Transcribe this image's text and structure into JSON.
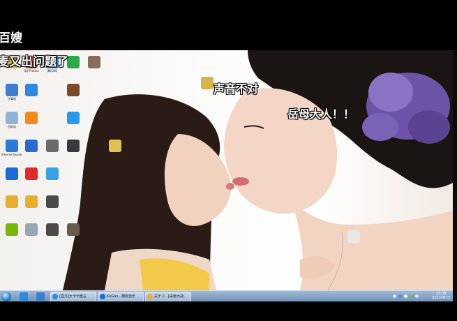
{
  "overlay_comments": [
    {
      "text": "百嫂"
    },
    {
      "text": "麦又出问题了"
    },
    {
      "text": "声音不对"
    },
    {
      "text": "岳母大人！！"
    }
  ],
  "desktop_icons": [
    {
      "label": "",
      "icon": "folder-icon",
      "color": "#d9b24a"
    },
    {
      "label": "QQ Protect",
      "icon": "qq-icon",
      "color": "#e23b2b"
    },
    {
      "label": "腾讯QQ",
      "icon": "qq-penguin-icon",
      "color": "#1a7fd6"
    },
    {
      "label": "",
      "icon": "green-app-icon",
      "color": "#2aa84a"
    },
    {
      "label": "",
      "icon": "image-file-icon",
      "color": "#8a6c5a"
    },
    {
      "label": "计算机",
      "icon": "computer-icon",
      "color": "#3b7fd0"
    },
    {
      "label": "",
      "icon": "browser-icon",
      "color": "#2a8ae0"
    },
    {
      "label": "",
      "icon": "video-file-icon",
      "color": "#7a4a2a"
    },
    {
      "label": "回收站",
      "icon": "recycle-bin-icon",
      "color": "#8fb3d8"
    },
    {
      "label": "",
      "icon": "orange-app-icon",
      "color": "#f08a1a"
    },
    {
      "label": "",
      "icon": "bird-app-icon",
      "color": "#2a9ae8"
    },
    {
      "label": "Internet Explorer",
      "icon": "ie-icon",
      "color": "#2a7ad8"
    },
    {
      "label": "",
      "icon": "shield-icon",
      "color": "#2a6ad0"
    },
    {
      "label": "",
      "icon": "phone-icon",
      "color": "#6a6a6a"
    },
    {
      "label": "",
      "icon": "video-file-icon",
      "color": "#3a3a3a"
    },
    {
      "label": "",
      "icon": "kugou-icon",
      "color": "#1a6ad8"
    },
    {
      "label": "",
      "icon": "media-player-icon",
      "color": "#e02a2a"
    },
    {
      "label": "",
      "icon": "photo-app-icon",
      "color": "#3aa0e8"
    },
    {
      "label": "",
      "icon": "game-app-icon",
      "color": "#e8b02a"
    },
    {
      "label": "",
      "icon": "game-app-icon",
      "color": "#e8b02a"
    },
    {
      "label": "",
      "icon": "video-file-icon",
      "color": "#4a4a4a"
    },
    {
      "label": "",
      "icon": "nvidia-icon",
      "color": "#76b900"
    },
    {
      "label": "",
      "icon": "keyboard-icon",
      "color": "#9aa6b2"
    },
    {
      "label": "",
      "icon": "video-file-icon",
      "color": "#4a4a4a"
    },
    {
      "label": "",
      "icon": "person-file-icon",
      "color": "#6a5a4a"
    },
    {
      "label": "",
      "icon": "folder-icon",
      "color": "#e0c050"
    },
    {
      "label": "",
      "icon": "file-icon",
      "color": "#e8e8e8"
    },
    {
      "label": "",
      "icon": "folder-icon",
      "color": "#d9b24a"
    }
  ],
  "taskbar": {
    "buttons": [
      {
        "label": "[直方]大卡卡盘古",
        "icon": "qq-icon",
        "color": "#2a8ae0"
      },
      {
        "label": "KuGou - 酷狗音乐",
        "icon": "kugou-icon",
        "color": "#1a6ad8"
      },
      {
        "label": "关于 2 - [采用大战...",
        "icon": "game-app-icon",
        "color": "#e8b02a"
      }
    ],
    "clock_time": "23:38",
    "clock_date": "2015/4/13"
  },
  "colors": {
    "overlay_text": "#ffffff",
    "taskbar": "#8aa8c8",
    "wallpaper_dress": "#7a5fb0"
  }
}
